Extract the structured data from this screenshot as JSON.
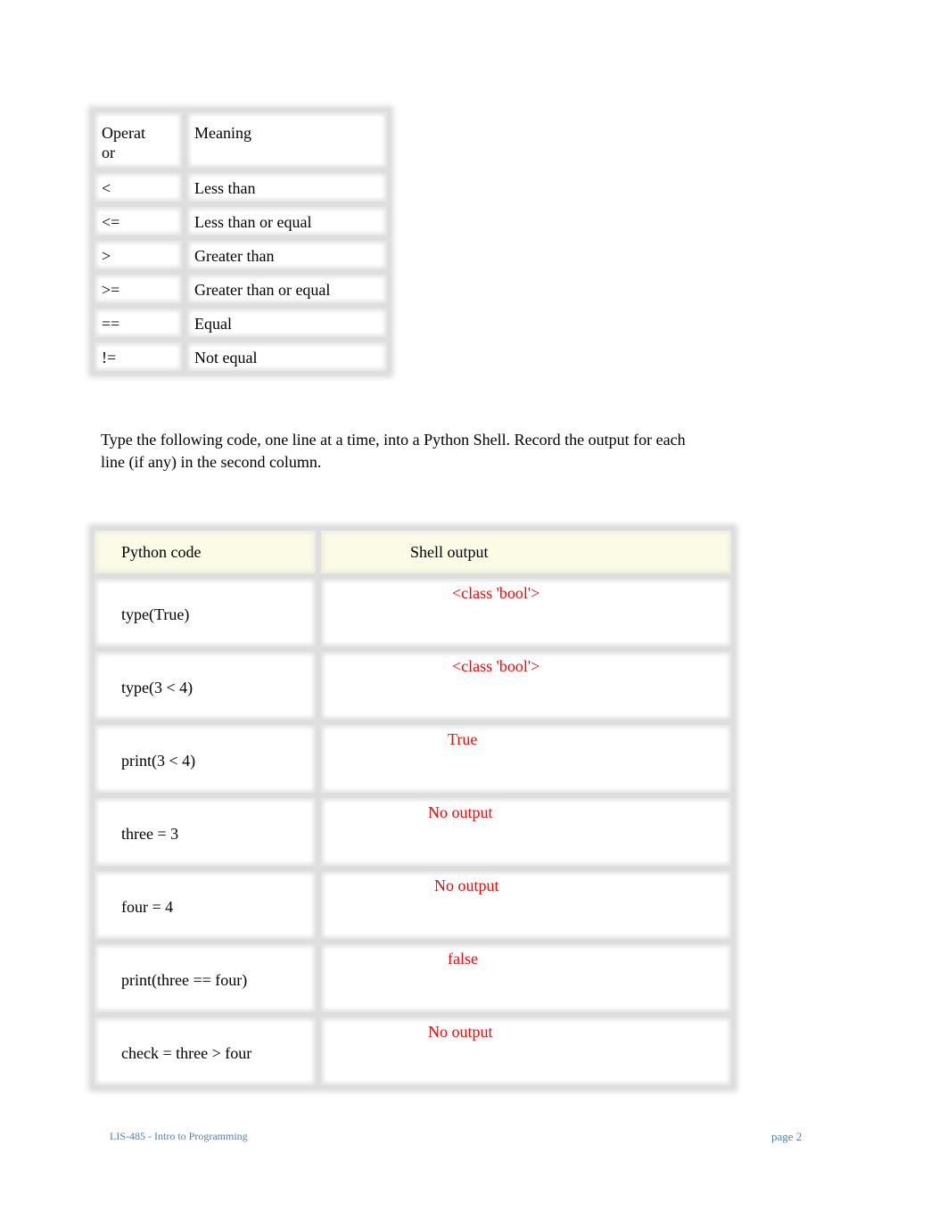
{
  "operators_table": {
    "headers": [
      "Operat or",
      "Meaning"
    ],
    "header_operator_lines": [
      "Operat",
      "or"
    ],
    "rows": [
      {
        "operator": "<",
        "meaning": "Less than"
      },
      {
        "operator": "<=",
        "meaning": "Less than or equal"
      },
      {
        "operator": ">",
        "meaning": "Greater than"
      },
      {
        "operator": ">=",
        "meaning": "Greater than or equal"
      },
      {
        "operator": "==",
        "meaning": "Equal"
      },
      {
        "operator": "!=",
        "meaning": "Not equal"
      }
    ]
  },
  "instructions": "Type the following code, one line at a time, into a Python Shell. Record the output for each line (if any) in the second column.",
  "code_table": {
    "headers": [
      "Python code",
      "Shell output"
    ],
    "rows": [
      {
        "code": "type(True)",
        "output": "<class 'bool'>"
      },
      {
        "code": "type(3 < 4)",
        "output": "<class 'bool'>"
      },
      {
        "code": "print(3 < 4)",
        "output": "True"
      },
      {
        "code": "three = 3",
        "output": "No output"
      },
      {
        "code": "four = 4",
        "output": "No output"
      },
      {
        "code": "print(three == four)",
        "output": "false"
      },
      {
        "code": "check = three > four",
        "output": "No output"
      }
    ],
    "answer_color": "#ff0000",
    "header_bg": "#fbfbe6"
  },
  "footer": {
    "course": "LIS-485 - Intro to Programming",
    "page": "page 2",
    "color": "#4f81bd"
  }
}
